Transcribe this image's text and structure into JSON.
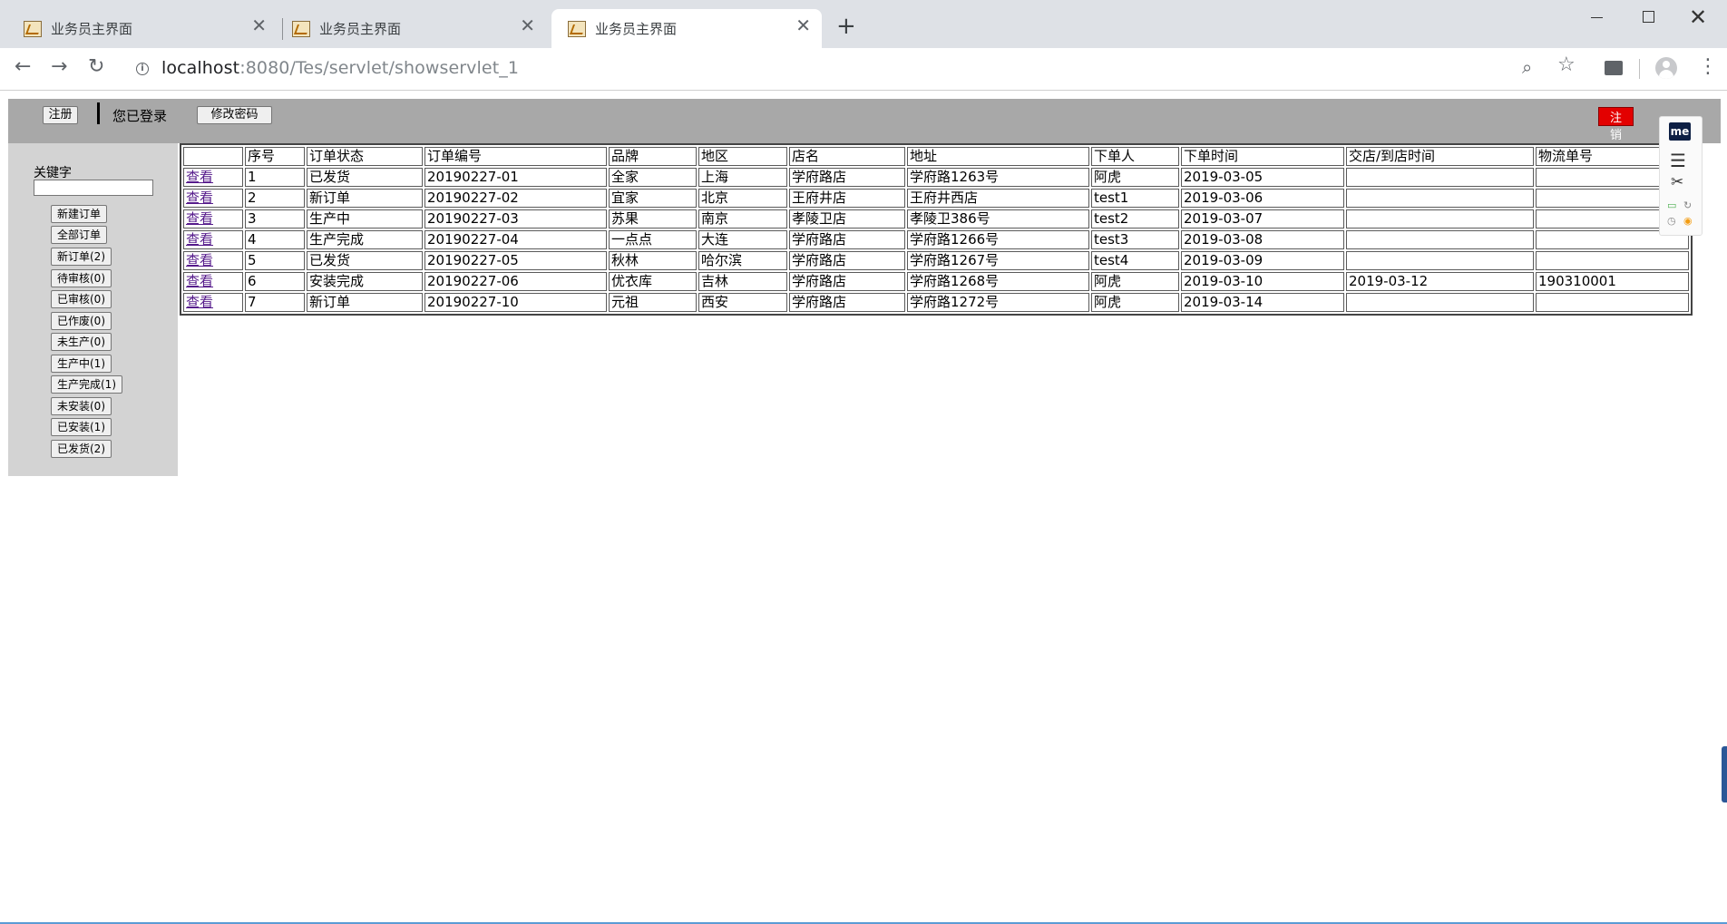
{
  "browser": {
    "tabs": [
      {
        "title": "业务员主界面",
        "active": false
      },
      {
        "title": "业务员主界面",
        "active": false
      },
      {
        "title": "业务员主界面",
        "active": true
      }
    ],
    "url_host": "localhost",
    "url_path": ":8080/Tes/servlet/showservlet_1",
    "icons": [
      "back-icon",
      "forward-icon",
      "reload-icon",
      "info-icon",
      "zoom-icon",
      "star-icon",
      "extension-icon",
      "avatar",
      "menu-icon"
    ]
  },
  "topbar": {
    "register_label": "注册",
    "logged_in_text": "您已登录",
    "change_password_label": "修改密码",
    "logout_label": "注销"
  },
  "sidebar": {
    "keyword_label": "关键字",
    "keyword_value": "",
    "buttons": [
      "新建订单",
      "全部订单",
      "新订单(2)",
      "待审核(0)",
      "已审核(0)",
      "已作废(0)",
      "未生产(0)",
      "生产中(1)",
      "生产完成(1)",
      "未安装(0)",
      "已安装(1)",
      "已发货(2)"
    ]
  },
  "table": {
    "headers": [
      "",
      "序号",
      "订单状态",
      "订单编号",
      "品牌",
      "地区",
      "店名",
      "地址",
      "下单人",
      "下单时间",
      "交店/到店时间",
      "物流单号"
    ],
    "rows": [
      [
        "查看",
        "1",
        "已发货",
        "20190227-01",
        "全家",
        "上海",
        "学府路店",
        "学府路1263号",
        "阿虎",
        "2019-03-05",
        "",
        ""
      ],
      [
        "查看",
        "2",
        "新订单",
        "20190227-02",
        "宜家",
        "北京",
        "王府井店",
        "王府井西店",
        "test1",
        "2019-03-06",
        "",
        ""
      ],
      [
        "查看",
        "3",
        "生产中",
        "20190227-03",
        "苏果",
        "南京",
        "孝陵卫店",
        "孝陵卫386号",
        "test2",
        "2019-03-07",
        "",
        ""
      ],
      [
        "查看",
        "4",
        "生产完成",
        "20190227-04",
        "一点点",
        "大连",
        "学府路店",
        "学府路1266号",
        "test3",
        "2019-03-08",
        "",
        ""
      ],
      [
        "查看",
        "5",
        "已发货",
        "20190227-05",
        "秋林",
        "哈尔滨",
        "学府路店",
        "学府路1267号",
        "test4",
        "2019-03-09",
        "",
        ""
      ],
      [
        "查看",
        "6",
        "安装完成",
        "20190227-06",
        "优衣库",
        "吉林",
        "学府路店",
        "学府路1268号",
        "阿虎",
        "2019-03-10",
        "2019-03-12",
        "190310001"
      ],
      [
        "查看",
        "7",
        "新订单",
        "20190227-10",
        "元祖",
        "西安",
        "学府路店",
        "学府路1272号",
        "阿虎",
        "2019-03-14",
        "",
        ""
      ]
    ]
  },
  "floating_toolbar": {
    "logo_text": "me"
  },
  "colors": {
    "topbar_bg": "#a8a8a8",
    "sidebar_bg": "#d3d3d3",
    "logout_bg": "#e30000",
    "link": "#551a8b"
  }
}
